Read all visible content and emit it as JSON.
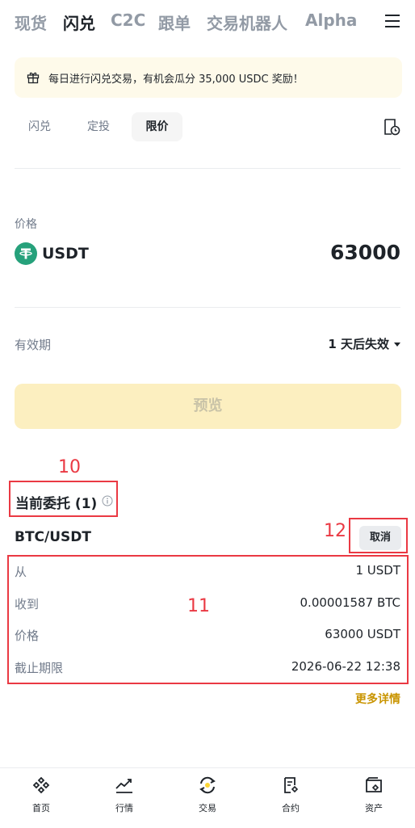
{
  "topnav": {
    "tabs": [
      "现货",
      "闪兑",
      "C2C",
      "跟单",
      "交易机器人",
      "Alpha"
    ],
    "active": "闪兑"
  },
  "banner": {
    "text": "每日进行闪兑交易，有机会瓜分 35,000 USDC 奖励！"
  },
  "subtabs": {
    "items": [
      "闪兑",
      "定投",
      "限价"
    ],
    "active": "限价"
  },
  "form": {
    "price_label": "价格",
    "coin": "USDT",
    "price_value": "63000",
    "expiry_label": "有效期",
    "expiry_value": "1 天后失效",
    "preview_button": "预览"
  },
  "annotations": {
    "orders_title": "10",
    "order_details": "11",
    "cancel": "12"
  },
  "orders": {
    "title": "当前委托 (1)",
    "pair": "BTC/USDT",
    "cancel_label": "取消",
    "rows": [
      {
        "label": "从",
        "value": "1 USDT"
      },
      {
        "label": "收到",
        "value": "0.00001587 BTC"
      },
      {
        "label": "价格",
        "value": "63000 USDT"
      },
      {
        "label": "截止期限",
        "value": "2026-06-22 12:38"
      }
    ],
    "more_details": "更多详情"
  },
  "bottomnav": {
    "items": [
      "首页",
      "行情",
      "交易",
      "合约",
      "资产"
    ]
  },
  "colors": {
    "accent": "#fcd535",
    "link": "#c99400",
    "annotation": "#ea3943"
  }
}
